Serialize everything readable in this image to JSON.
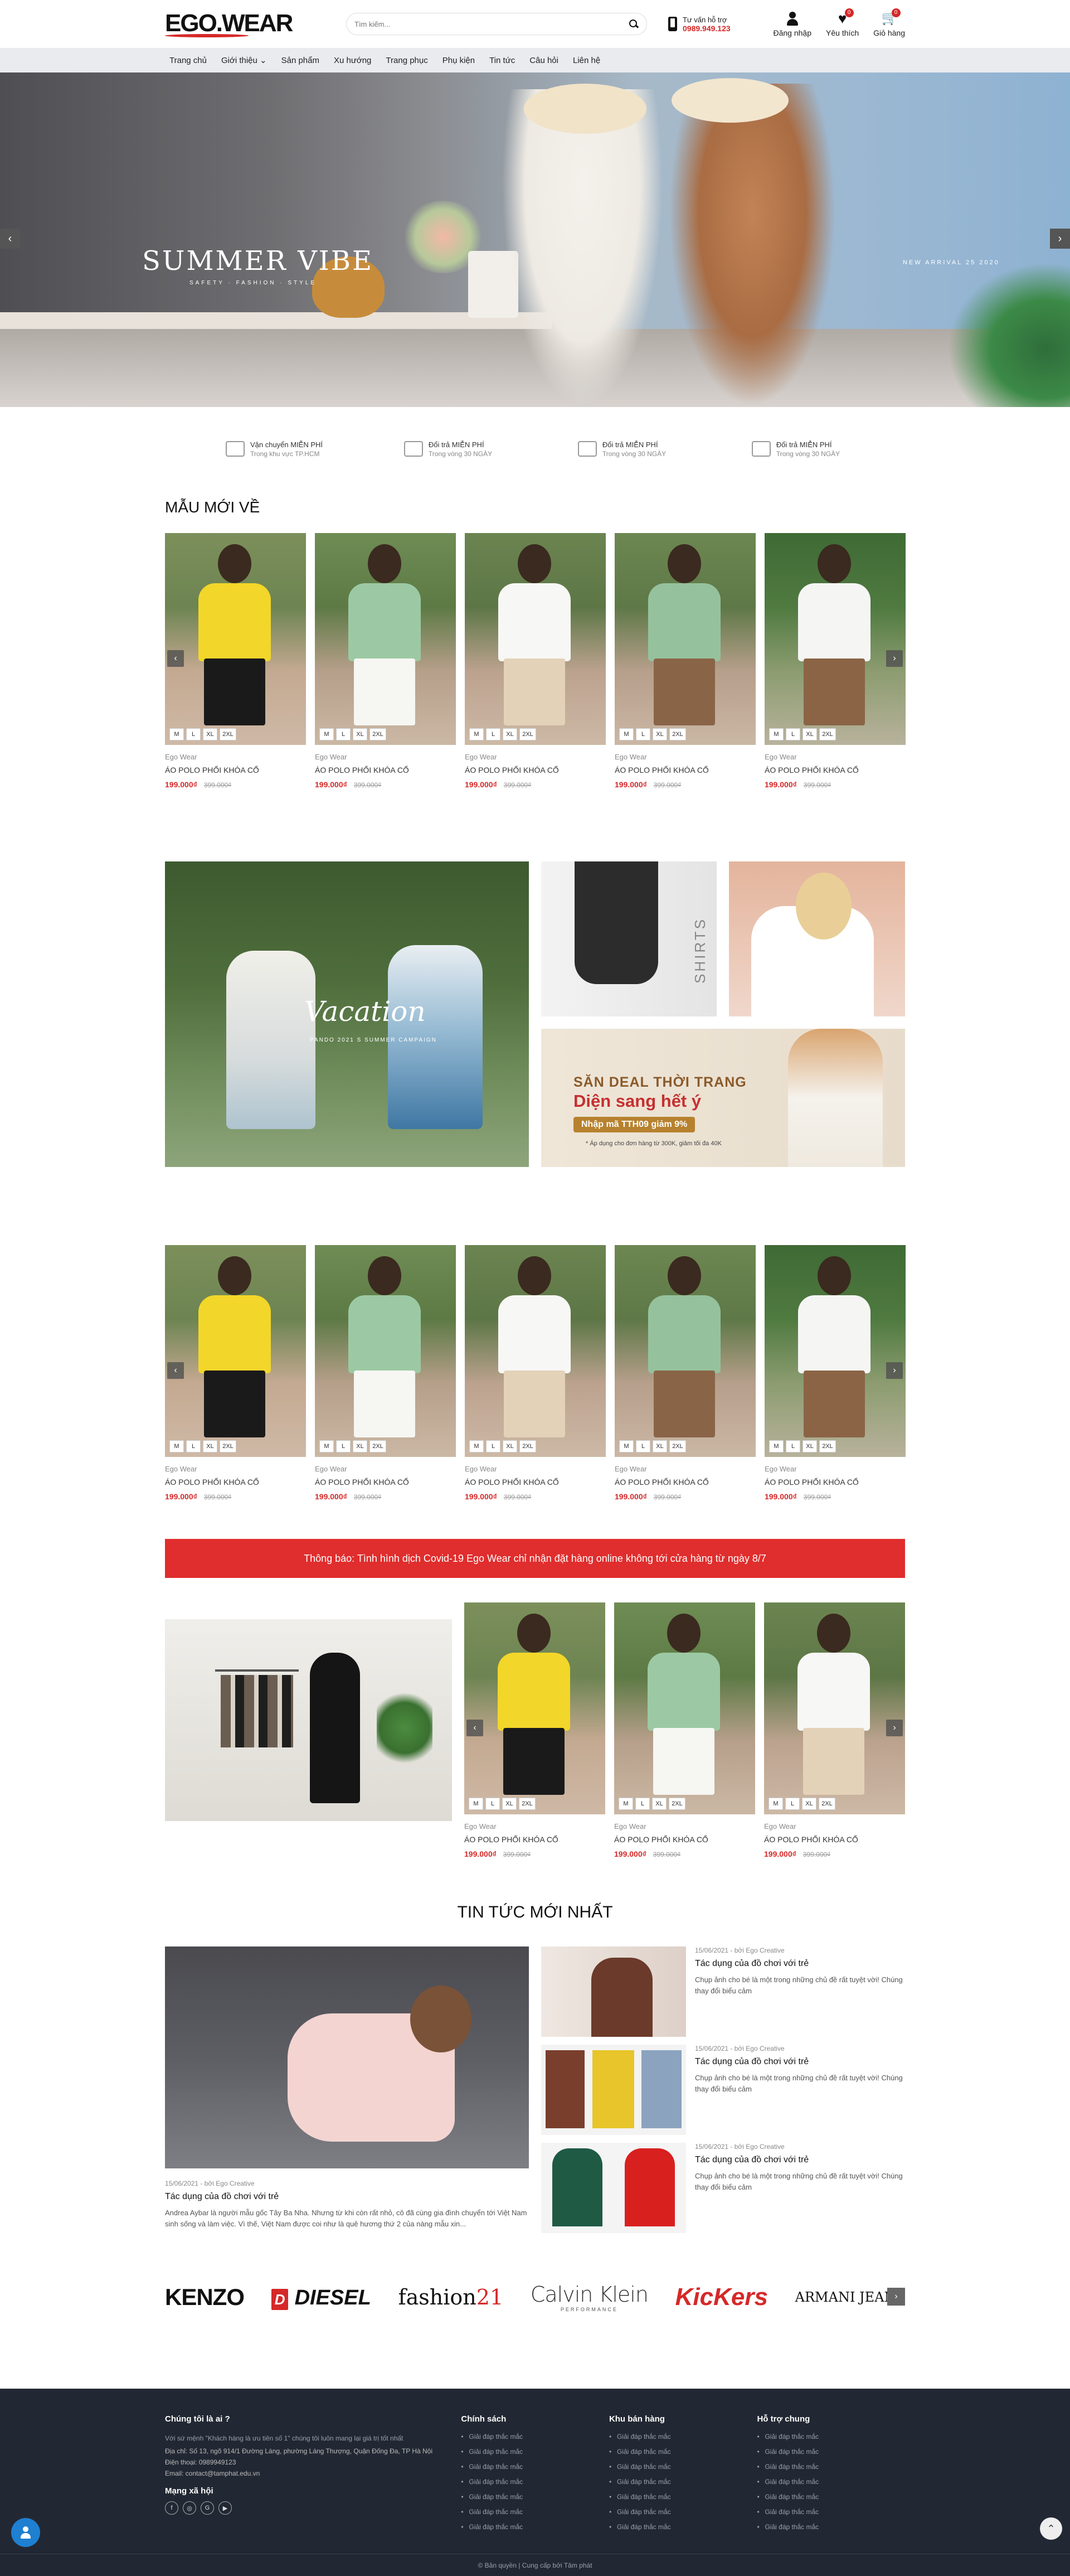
{
  "header": {
    "logo": "EGO.WEAR",
    "search_placeholder": "Tìm kiếm...",
    "hotline_label": "Tư vấn hỗ trợ",
    "hotline_number": "0989.949.123",
    "login": "Đăng nhập",
    "wishlist": "Yêu thích",
    "wishlist_count": "0",
    "cart": "Giỏ hàng",
    "cart_count": "0"
  },
  "nav": [
    "Trang chủ",
    "Giới thiệu ⌄",
    "Sản phẩm",
    "Xu hướng",
    "Trang phục",
    "Phụ kiện",
    "Tin tức",
    "Câu hỏi",
    "Liên hệ"
  ],
  "hero": {
    "title": "SUMMER VIBE",
    "subtitle": "SAFETY · FASHION · STYLE",
    "right_text": "NEW ARRIVAL 25 2020"
  },
  "features": [
    {
      "title": "Vận chuyển MIỄN PHÍ",
      "sub": "Trong khu vực TP.HCM"
    },
    {
      "title": "Đổi trả MIỄN PHÍ",
      "sub": "Trong vòng 30 NGÀY"
    },
    {
      "title": "Đổi trả MIỄN PHÍ",
      "sub": "Trong vòng 30 NGÀY"
    },
    {
      "title": "Đổi trả MIỄN PHÍ",
      "sub": "Trong vòng 30 NGÀY"
    }
  ],
  "section_new": "MẪU MỚI VỀ",
  "product": {
    "brand": "Ego Wear",
    "name": "ÁO POLO PHỐI KHÓA CỔ",
    "price": "199.000₫",
    "old_price": "399.000₫",
    "sizes": [
      "M",
      "L",
      "XL",
      "2XL"
    ]
  },
  "banners": {
    "vacation": "Vacation",
    "vacation_sub": "PANDO 2021 S SUMMER CAMPAIGN",
    "shirts": "SHIRTS",
    "deal_line1": "SĂN DEAL THỜI TRANG",
    "deal_line2": "Diện sang hết ý",
    "deal_code": "Nhập mã TTH09 giảm 9%",
    "deal_note": "* Áp dụng cho đơn hàng từ 300K, giảm tối đa 40K"
  },
  "notice": "Thông báo: Tình hình dịch Covid-19 Ego Wear chỉ nhận đặt hàng online không tới cửa hàng từ ngày 8/7",
  "news": {
    "title": "TIN TỨC MỚI NHẤT",
    "meta": "15/06/2021 - bởi Ego Creative",
    "item_title": "Tác dụng của đồ chơi với trẻ",
    "main_desc": "Andrea Aybar là người mẫu gốc Tây Ba Nha. Nhưng từ khi còn rất nhỏ, cô đã cùng gia đình chuyển tới Việt Nam sinh sống và làm việc. Vì thế, Việt Nam được coi như là quê hương thứ 2 của nàng mẫu xin...",
    "side_desc": "Chụp ảnh cho bé là một trong những chủ đề rất tuyệt vời! Chúng thay đổi biểu cảm"
  },
  "brands": {
    "kenzo": "KENZO",
    "diesel_mark": "D",
    "diesel": "DIESEL",
    "fashion": "fashion",
    "fashion_num": "21",
    "ck": "Calvin Klein",
    "ck_sub": "PERFORMANCE",
    "kickers": "KicKers",
    "armani": "ARMANI JEANS"
  },
  "footer": {
    "about_title": "Chúng tôi là ai ?",
    "about_text": "Với sứ mệnh \"Khách hàng là ưu tiên số 1\" chúng tôi luôn mang lại giá trị tốt nhất",
    "address": "Địa chỉ: Số 13, ngõ 914/1 Đường Láng, phường Láng Thượng, Quận Đống Đa, TP Hà Nội",
    "phone": "Điện thoại: 0989949123",
    "email": "Email: contact@tamphat.edu.vn",
    "social_title": "Mạng xã hội",
    "col2_title": "Chính sách",
    "col3_title": "Khu bán hàng",
    "col4_title": "Hỗ trợ chung",
    "link": "Giải đáp thắc mắc",
    "copyright": "© Bản quyền | Cung cấp bởi Tâm phát"
  }
}
